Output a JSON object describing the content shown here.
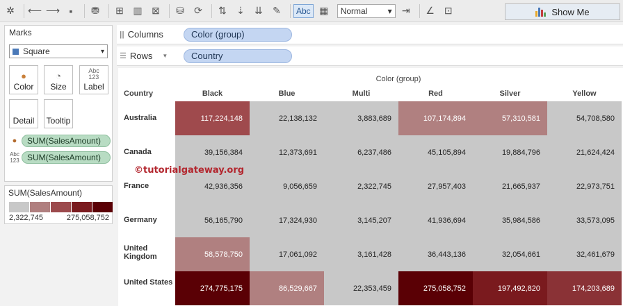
{
  "toolbar": {
    "abc_label": "Abc",
    "fit_value": "Normal",
    "show_me_label": "Show Me"
  },
  "marks": {
    "title": "Marks",
    "mark_type": "Square",
    "buttons": [
      "Color",
      "Size",
      "Label",
      "Detail",
      "Tooltip"
    ],
    "label_icon_text": "Abc\n123",
    "pills": [
      {
        "icon": "color",
        "label": "SUM(SalesAmount)"
      },
      {
        "icon": "label",
        "label": "SUM(SalesAmount)"
      }
    ]
  },
  "legend": {
    "title": "SUM(SalesAmount)",
    "colors": [
      "#c8c8c8",
      "#b07f7f",
      "#9c4a4d",
      "#7a1a1e",
      "#5a0005"
    ],
    "min": "2,322,745",
    "max": "275,058,752"
  },
  "shelves": {
    "columns_label": "Columns",
    "columns_pill": "Color (group)",
    "rows_label": "Rows",
    "rows_pill": "Country"
  },
  "table": {
    "column_group_title": "Color (group)",
    "row_header_title": "Country",
    "columns": [
      "Black",
      "Blue",
      "Multi",
      "Red",
      "Silver",
      "Yellow"
    ],
    "rows": [
      {
        "country": "Australia",
        "values": [
          "117,224,148",
          "22,138,132",
          "3,883,689",
          "107,174,894",
          "57,310,581",
          "54,708,580"
        ],
        "colors": [
          "#9f4a4d",
          "#c8c8c8",
          "#c8c8c8",
          "#b08080",
          "#b08080",
          "#c8c8c8"
        ],
        "text_light": [
          true,
          false,
          false,
          true,
          true,
          false
        ]
      },
      {
        "country": "Canada",
        "values": [
          "39,156,384",
          "12,373,691",
          "6,237,486",
          "45,105,894",
          "19,884,796",
          "21,624,424"
        ],
        "colors": [
          "#c8c8c8",
          "#c8c8c8",
          "#c8c8c8",
          "#c8c8c8",
          "#c8c8c8",
          "#c8c8c8"
        ],
        "text_light": [
          false,
          false,
          false,
          false,
          false,
          false
        ]
      },
      {
        "country": "France",
        "values": [
          "42,936,356",
          "9,056,659",
          "2,322,745",
          "27,957,403",
          "21,665,937",
          "22,973,751"
        ],
        "colors": [
          "#c8c8c8",
          "#c8c8c8",
          "#c8c8c8",
          "#c8c8c8",
          "#c8c8c8",
          "#c8c8c8"
        ],
        "text_light": [
          false,
          false,
          false,
          false,
          false,
          false
        ]
      },
      {
        "country": "Germany",
        "values": [
          "56,165,790",
          "17,324,930",
          "3,145,207",
          "41,936,694",
          "35,984,586",
          "33,573,095"
        ],
        "colors": [
          "#c8c8c8",
          "#c8c8c8",
          "#c8c8c8",
          "#c8c8c8",
          "#c8c8c8",
          "#c8c8c8"
        ],
        "text_light": [
          false,
          false,
          false,
          false,
          false,
          false
        ]
      },
      {
        "country": "United Kingdom",
        "values": [
          "58,578,750",
          "17,061,092",
          "3,161,428",
          "36,443,136",
          "32,054,661",
          "32,461,679"
        ],
        "colors": [
          "#b08080",
          "#c8c8c8",
          "#c8c8c8",
          "#c8c8c8",
          "#c8c8c8",
          "#c8c8c8"
        ],
        "text_light": [
          true,
          false,
          false,
          false,
          false,
          false
        ]
      },
      {
        "country": "United States",
        "values": [
          "274,775,175",
          "86,529,667",
          "22,353,459",
          "275,058,752",
          "197,492,820",
          "174,203,689"
        ],
        "colors": [
          "#5a0005",
          "#b08080",
          "#c8c8c8",
          "#5a0005",
          "#7a1a1e",
          "#8a3236"
        ],
        "text_light": [
          true,
          true,
          false,
          true,
          true,
          true
        ]
      }
    ]
  },
  "watermark": "©tutorialgateway.org"
}
